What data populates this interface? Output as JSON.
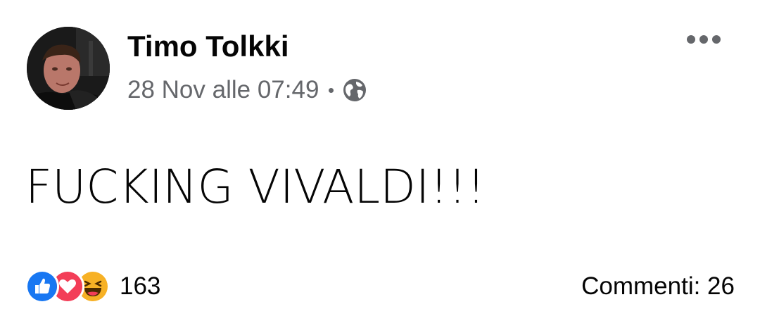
{
  "post": {
    "author_name": "Timo Tolkki",
    "timestamp": "28 Nov alle 07:49",
    "privacy_icon": "globe-icon",
    "message": "FUCKING VIVALDI!!!",
    "reactions": {
      "icons": [
        "like-icon",
        "love-icon",
        "haha-icon"
      ],
      "count": "163"
    },
    "comments_label": "Commenti: 26",
    "more_icon": "more-options-icon"
  },
  "colors": {
    "text_primary": "#050505",
    "text_secondary": "#65676b",
    "like_blue": "#1877f2",
    "love_red": "#f33e58",
    "haha_yellow": "#f7b125"
  }
}
